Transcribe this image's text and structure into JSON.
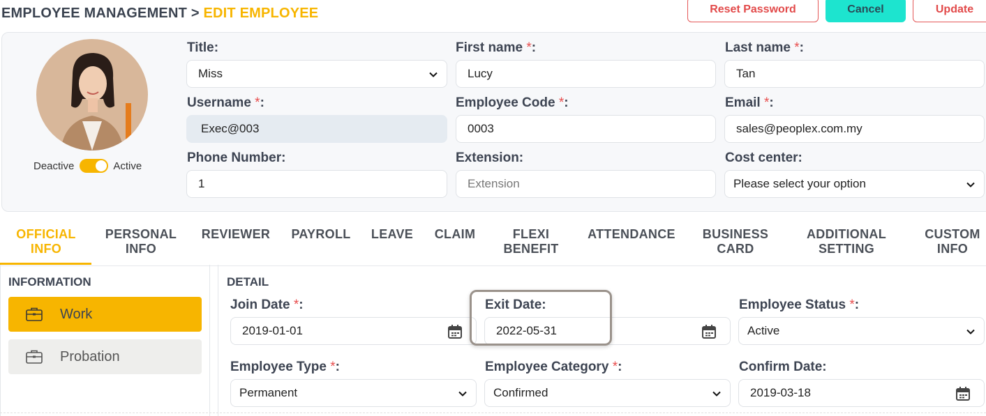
{
  "breadcrumb": {
    "root": "EMPLOYEE MANAGEMENT",
    "sep": ">",
    "current": "EDIT EMPLOYEE"
  },
  "actions": {
    "reset_password": "Reset Password",
    "cancel": "Cancel",
    "update": "Update"
  },
  "colors": {
    "accent": "#f7b500",
    "teal": "#1de4cf",
    "danger": "#e24a4a"
  },
  "profile": {
    "status_toggle": {
      "off_label": "Deactive",
      "on_label": "Active",
      "is_active": true
    },
    "title": {
      "label": "Title:",
      "value": "Miss"
    },
    "first_name": {
      "label": "First name",
      "value": "Lucy"
    },
    "last_name": {
      "label": "Last name",
      "value": "Tan"
    },
    "username": {
      "label": "Username",
      "value": "Exec@003"
    },
    "employee_code": {
      "label": "Employee Code",
      "value": "0003"
    },
    "email": {
      "label": "Email",
      "value": "sales@peoplex.com.my"
    },
    "phone": {
      "label": "Phone Number:",
      "value": "1"
    },
    "extension": {
      "label": "Extension:",
      "placeholder": "Extension"
    },
    "cost_center": {
      "label": "Cost center:",
      "value": "Please select your option"
    },
    "required_mark": "*",
    "colon": ":"
  },
  "tabs": [
    {
      "line1": "OFFICIAL",
      "line2": "INFO"
    },
    {
      "line1": "PERSONAL",
      "line2": "INFO"
    },
    {
      "line1": "REVIEWER",
      "line2": ""
    },
    {
      "line1": "PAYROLL",
      "line2": ""
    },
    {
      "line1": "LEAVE",
      "line2": ""
    },
    {
      "line1": "CLAIM",
      "line2": ""
    },
    {
      "line1": "FLEXI",
      "line2": "BENEFIT"
    },
    {
      "line1": "ATTENDANCE",
      "line2": ""
    },
    {
      "line1": "BUSINESS",
      "line2": "CARD"
    },
    {
      "line1": "ADDITIONAL",
      "line2": "SETTING"
    },
    {
      "line1": "CUSTOM",
      "line2": "INFO"
    }
  ],
  "sidebar": {
    "title": "INFORMATION",
    "items": [
      {
        "label": "Work",
        "icon": "briefcase-icon"
      },
      {
        "label": "Probation",
        "icon": "briefcase-icon"
      }
    ]
  },
  "detail": {
    "title": "DETAIL",
    "join_date": {
      "label": "Join Date",
      "value": "2019-01-01"
    },
    "exit_date": {
      "label": "Exit Date:",
      "value": "2022-05-31"
    },
    "employee_status": {
      "label": "Employee Status",
      "value": "Active"
    },
    "employee_type": {
      "label": "Employee Type",
      "value": "Permanent"
    },
    "employee_category": {
      "label": "Employee Category",
      "value": "Confirmed"
    },
    "confirm_date": {
      "label": "Confirm Date:",
      "value": "2019-03-18"
    }
  }
}
